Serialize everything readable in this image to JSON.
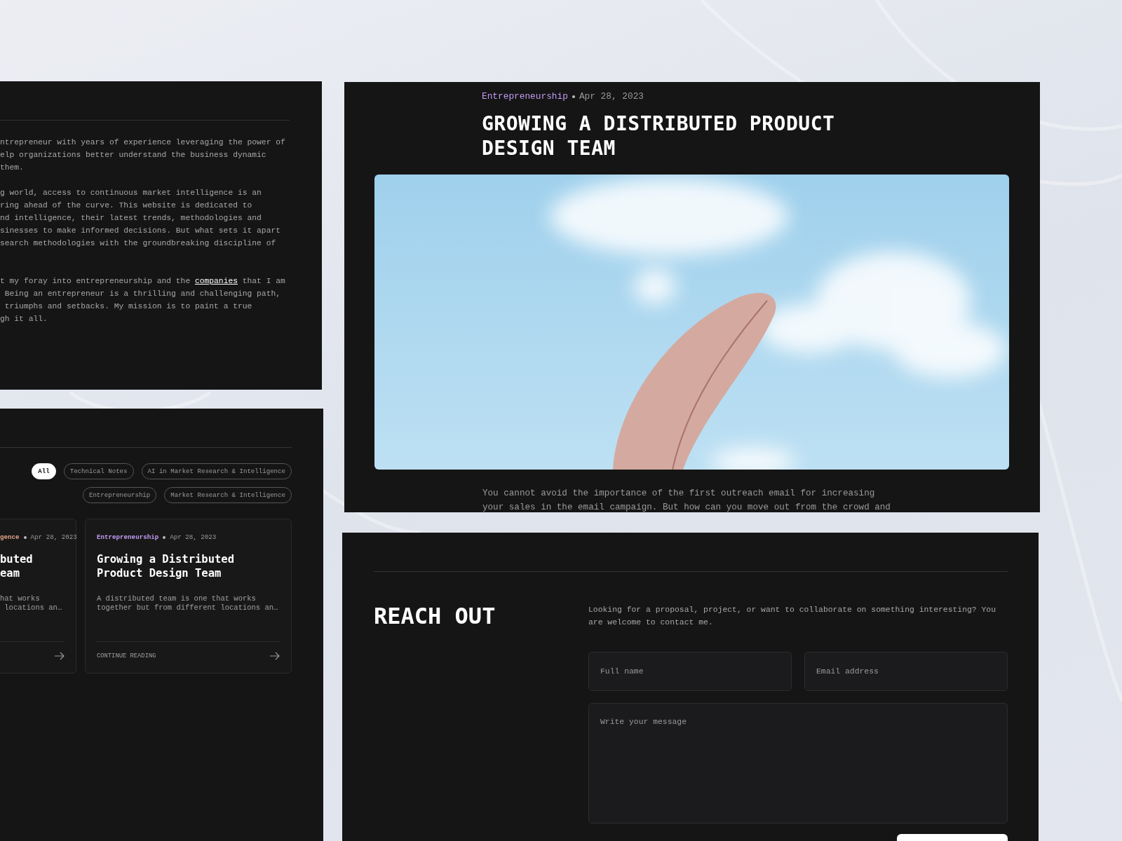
{
  "about_panel": {
    "paragraphs": [
      "ntrepreneur with years of experience leveraging the power of\nelp organizations better understand the business dynamic\nthem.",
      "g world, access to continuous market intelligence is an\nring ahead of the curve. This website is dedicated to\nnd intelligence, their latest trends, methodologies and\nsinesses to make informed decisions. But what sets it apart\nsearch methodologies with the groundbreaking discipline of"
    ],
    "link_paragraph": {
      "before": "t my foray into entrepreneurship and the ",
      "link": "companies",
      "after": " that I am\n Being an entrepreneur is a thrilling and challenging path,\n triumphs and setbacks. My mission is to paint a true\ngh it all."
    }
  },
  "blog_panel": {
    "filters": [
      {
        "label": "All",
        "selected": true
      },
      {
        "label": "Technical Notes",
        "selected": false
      },
      {
        "label": "AI in Market Research & Intelligence",
        "selected": false
      },
      {
        "label": "Entrepreneurship",
        "selected": false
      },
      {
        "label": "Market Research & Intelligence",
        "selected": false
      }
    ],
    "posts": [
      {
        "category": "gence",
        "color": "#e0a184",
        "date": "Apr 28, 2023",
        "title": "buted\neam",
        "excerpt": "hat works\n locations an…"
      },
      {
        "category": "Entrepreneurship",
        "color": "#c39cf5",
        "date": "Apr 28, 2023",
        "title": "Growing a Distributed\nProduct Design Team",
        "excerpt": "A distributed team is one that works\ntogether but from different locations an…",
        "cta": "CONTINUE READING"
      }
    ]
  },
  "article": {
    "category": "Entrepreneurship",
    "color": "#c39cf5",
    "date": "Apr 28, 2023",
    "title": "GROWING A DISTRIBUTED PRODUCT\nDESIGN TEAM",
    "body": "You cannot avoid the importance of the first outreach email for increasing\nyour sales in the email campaign. But how can you move out from the crowd and"
  },
  "contact": {
    "heading": "REACH OUT",
    "description": "Looking for a proposal, project, or want to collaborate on something interesting? You are welcome to contact me.",
    "fields": [
      {
        "kind": "input",
        "placeholder": "Full name"
      },
      {
        "kind": "input",
        "placeholder": "Email address"
      },
      {
        "kind": "textarea",
        "placeholder": "Write your message"
      }
    ]
  }
}
